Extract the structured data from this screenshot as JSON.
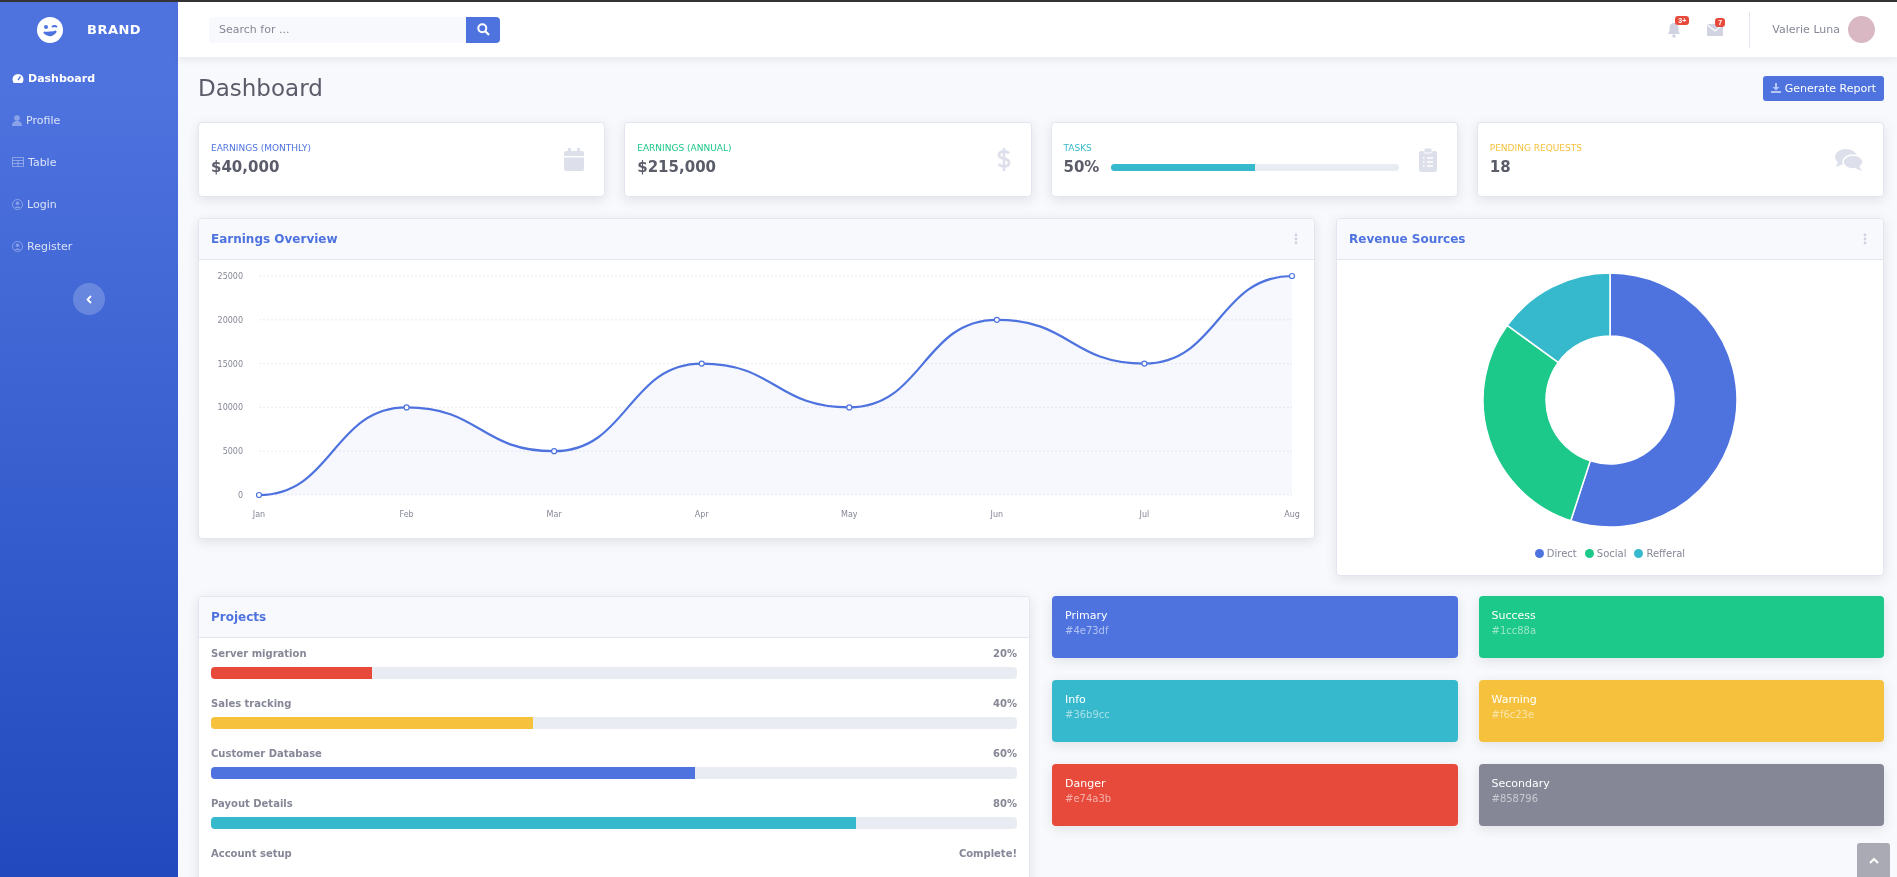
{
  "sidebar": {
    "brand": "BRAND",
    "items": [
      {
        "label": "Dashboard",
        "selected": true
      },
      {
        "label": "Profile",
        "selected": false
      },
      {
        "label": "Table",
        "selected": false
      },
      {
        "label": "Login",
        "selected": false
      },
      {
        "label": "Register",
        "selected": false
      }
    ]
  },
  "topbar": {
    "search": {
      "placeholder": "Search for ..."
    },
    "alerts_badge": "3+",
    "messages_badge": "7",
    "user_name": "Valerie Luna"
  },
  "page_title": "Dashboard",
  "report_button": "Generate Report",
  "stat_cards": [
    {
      "kind": "value",
      "label": "EARNINGS (MONTHLY)",
      "value": "$40,000",
      "color": "#4e73df"
    },
    {
      "kind": "value",
      "label": "EARNINGS (ANNUAL)",
      "value": "$215,000",
      "color": "#1cc88a"
    },
    {
      "kind": "progress",
      "label": "TASKS",
      "value": "50%",
      "color": "#36b9cc",
      "level": 0.5
    },
    {
      "kind": "value",
      "label": "PENDING REQUESTS",
      "value": "18",
      "color": "#f6c23e"
    }
  ],
  "earnings_overview": {
    "title": "Earnings Overview",
    "chart_data": {
      "type": "area",
      "categories": [
        "Jan",
        "Feb",
        "Mar",
        "Apr",
        "May",
        "Jun",
        "Jul",
        "Aug"
      ],
      "series": [
        {
          "color": "#4e73df",
          "values": [
            0,
            10000,
            5000,
            15000,
            10000,
            20000,
            15000,
            25000
          ]
        }
      ],
      "grid": true,
      "ylim": [
        0,
        25000
      ],
      "yticks": [
        0,
        5000,
        10000,
        15000,
        20000,
        25000
      ]
    }
  },
  "revenue_sources": {
    "title": "Revenue Sources",
    "chart_data": {
      "type": "donut",
      "categories": [
        "Direct",
        "Social",
        "Refferal"
      ],
      "colors": [
        "#4e73df",
        "#1cc88a",
        "#36b9cc"
      ],
      "series": [
        {
          "values": [
            55,
            30,
            15
          ]
        }
      ],
      "legend": true
    }
  },
  "projects": {
    "title": "Projects",
    "items": [
      {
        "name": "Server migration",
        "reading": "20%",
        "level": 0.2,
        "color": "#e74a3b"
      },
      {
        "name": "Sales tracking",
        "reading": "40%",
        "level": 0.4,
        "color": "#f6c23e"
      },
      {
        "name": "Customer Database",
        "reading": "60%",
        "level": 0.6,
        "color": "#4e73df"
      },
      {
        "name": "Payout Details",
        "reading": "80%",
        "level": 0.8,
        "color": "#36b9cc"
      },
      {
        "name": "Account setup",
        "reading": "Complete!"
      }
    ]
  },
  "color_cards": [
    {
      "name": "Primary",
      "code": "#4e73df",
      "color": "#4e73df"
    },
    {
      "name": "Success",
      "code": "#1cc88a",
      "color": "#1cc88a"
    },
    {
      "name": "Info",
      "code": "#36b9cc",
      "color": "#36b9cc"
    },
    {
      "name": "Warning",
      "code": "#f6c23e",
      "color": "#f6c23e"
    },
    {
      "name": "Danger",
      "code": "#e74a3b",
      "color": "#e74a3b"
    },
    {
      "name": "Secondary",
      "code": "#858796",
      "color": "#858796"
    }
  ]
}
